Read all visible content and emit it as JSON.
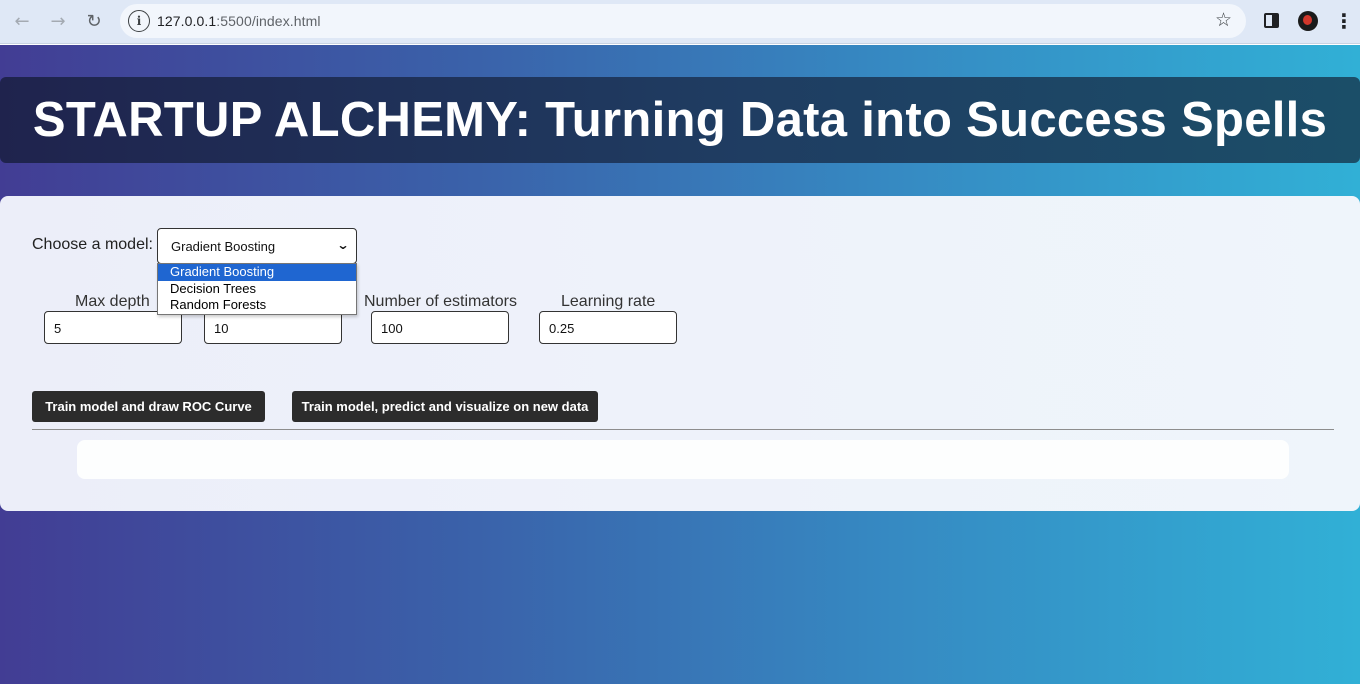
{
  "browser": {
    "url_host": "127.0.0.1",
    "url_path": ":5500/index.html",
    "back_icon": "arrow-left-icon",
    "forward_icon": "arrow-right-icon",
    "reload_icon": "reload-icon",
    "site_info_glyph": "i",
    "star_glyph": "☆",
    "menu_glyph": "⋮"
  },
  "header": {
    "title": "STARTUP ALCHEMY: Turning Data into Success Spells"
  },
  "form": {
    "model_label": "Choose a model:",
    "model_selected": "Gradient Boosting",
    "model_options": [
      "Gradient Boosting",
      "Decision Trees",
      "Random Forests"
    ],
    "params": [
      {
        "label": "Max depth",
        "value": "5"
      },
      {
        "label": "",
        "value": "10"
      },
      {
        "label": "Number of estimators",
        "value": "100"
      },
      {
        "label": "Learning rate",
        "value": "0.25"
      }
    ],
    "buttons": {
      "roc": "Train model and draw ROC Curve",
      "predict": "Train model, predict and visualize on new data"
    }
  },
  "colors": {
    "page_gradient_start": "#423d94",
    "page_gradient_end": "#31b0d6",
    "banner": "#1f2b55",
    "button": "#2c2c2c",
    "selected_option": "#1f66d1"
  }
}
